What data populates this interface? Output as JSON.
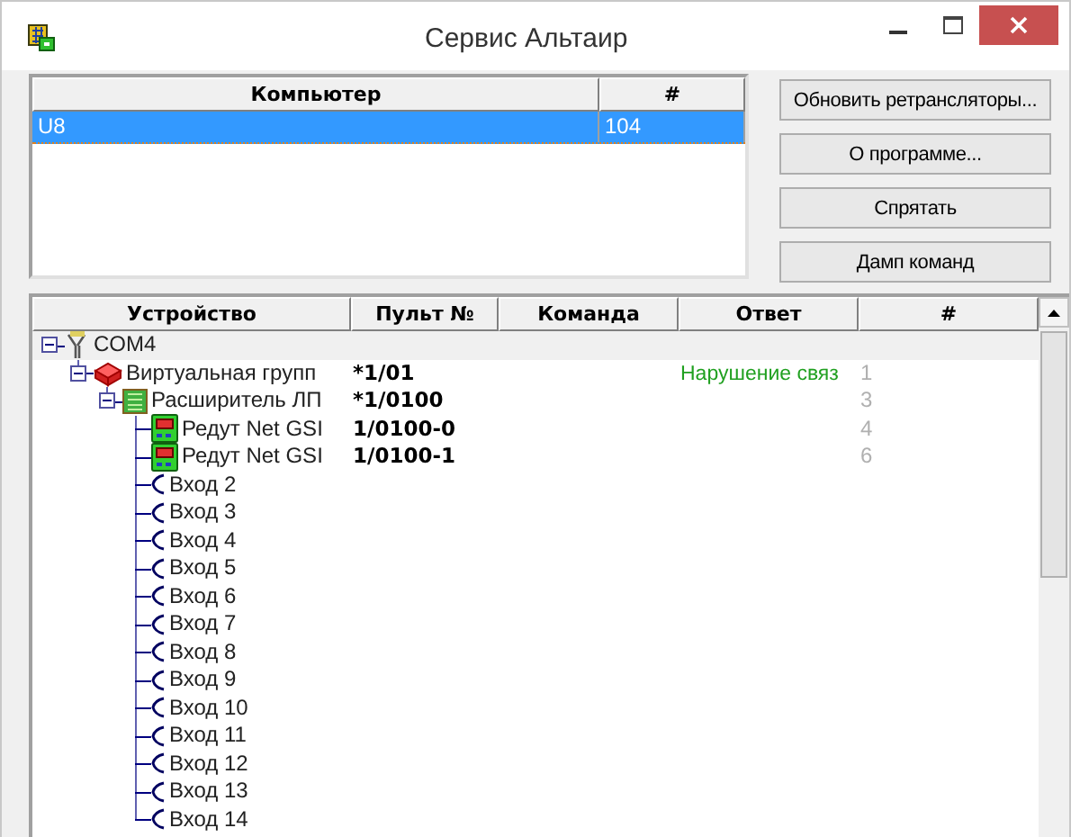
{
  "window": {
    "title": "Сервис Альтаир"
  },
  "computers": {
    "columns": [
      "Компьютер",
      "#"
    ],
    "rows": [
      {
        "cells": [
          "U8",
          "104"
        ],
        "selected": true
      }
    ]
  },
  "buttons": [
    "Обновить ретрансляторы...",
    "О программе...",
    "Спрятать",
    "Дамп команд"
  ],
  "device_tree": {
    "columns": [
      "Устройство",
      "Пульт №",
      "Команда",
      "Ответ",
      "#"
    ],
    "rows": [
      {
        "kind": "port",
        "name": "COM4",
        "selected": true,
        "expanded": true,
        "children": [
          {
            "kind": "group",
            "name": "Виртуальная групп",
            "pult": "*1/01",
            "answer": "Нарушение связ",
            "number": "1",
            "selected": false,
            "expanded": true,
            "children": [
              {
                "kind": "expander",
                "name": "Расширитель ЛП",
                "pult": "*1/0100",
                "number": "3",
                "selected": false,
                "expanded": true,
                "children": [
                  {
                    "kind": "device",
                    "name": "Редут Net GSI",
                    "pult": "1/0100-0",
                    "number": "4",
                    "selected": false
                  },
                  {
                    "kind": "device",
                    "name": "Редут Net GSI",
                    "pult": "1/0100-1",
                    "number": "6",
                    "selected": false
                  },
                  {
                    "kind": "input",
                    "name": "Вход 2",
                    "selected": false
                  },
                  {
                    "kind": "input",
                    "name": "Вход 3",
                    "selected": false
                  },
                  {
                    "kind": "input",
                    "name": "Вход 4",
                    "selected": false
                  },
                  {
                    "kind": "input",
                    "name": "Вход 5",
                    "selected": false
                  },
                  {
                    "kind": "input",
                    "name": "Вход 6",
                    "selected": false
                  },
                  {
                    "kind": "input",
                    "name": "Вход 7",
                    "selected": false
                  },
                  {
                    "kind": "input",
                    "name": "Вход 8",
                    "selected": false
                  },
                  {
                    "kind": "input",
                    "name": "Вход 9",
                    "selected": false
                  },
                  {
                    "kind": "input",
                    "name": "Вход 10",
                    "selected": false
                  },
                  {
                    "kind": "input",
                    "name": "Вход 11",
                    "selected": false
                  },
                  {
                    "kind": "input",
                    "name": "Вход 12",
                    "selected": false
                  },
                  {
                    "kind": "input",
                    "name": "Вход 13",
                    "selected": false
                  },
                  {
                    "kind": "input",
                    "name": "Вход 14",
                    "selected": false
                  }
                ]
              }
            ]
          }
        ]
      }
    ]
  }
}
